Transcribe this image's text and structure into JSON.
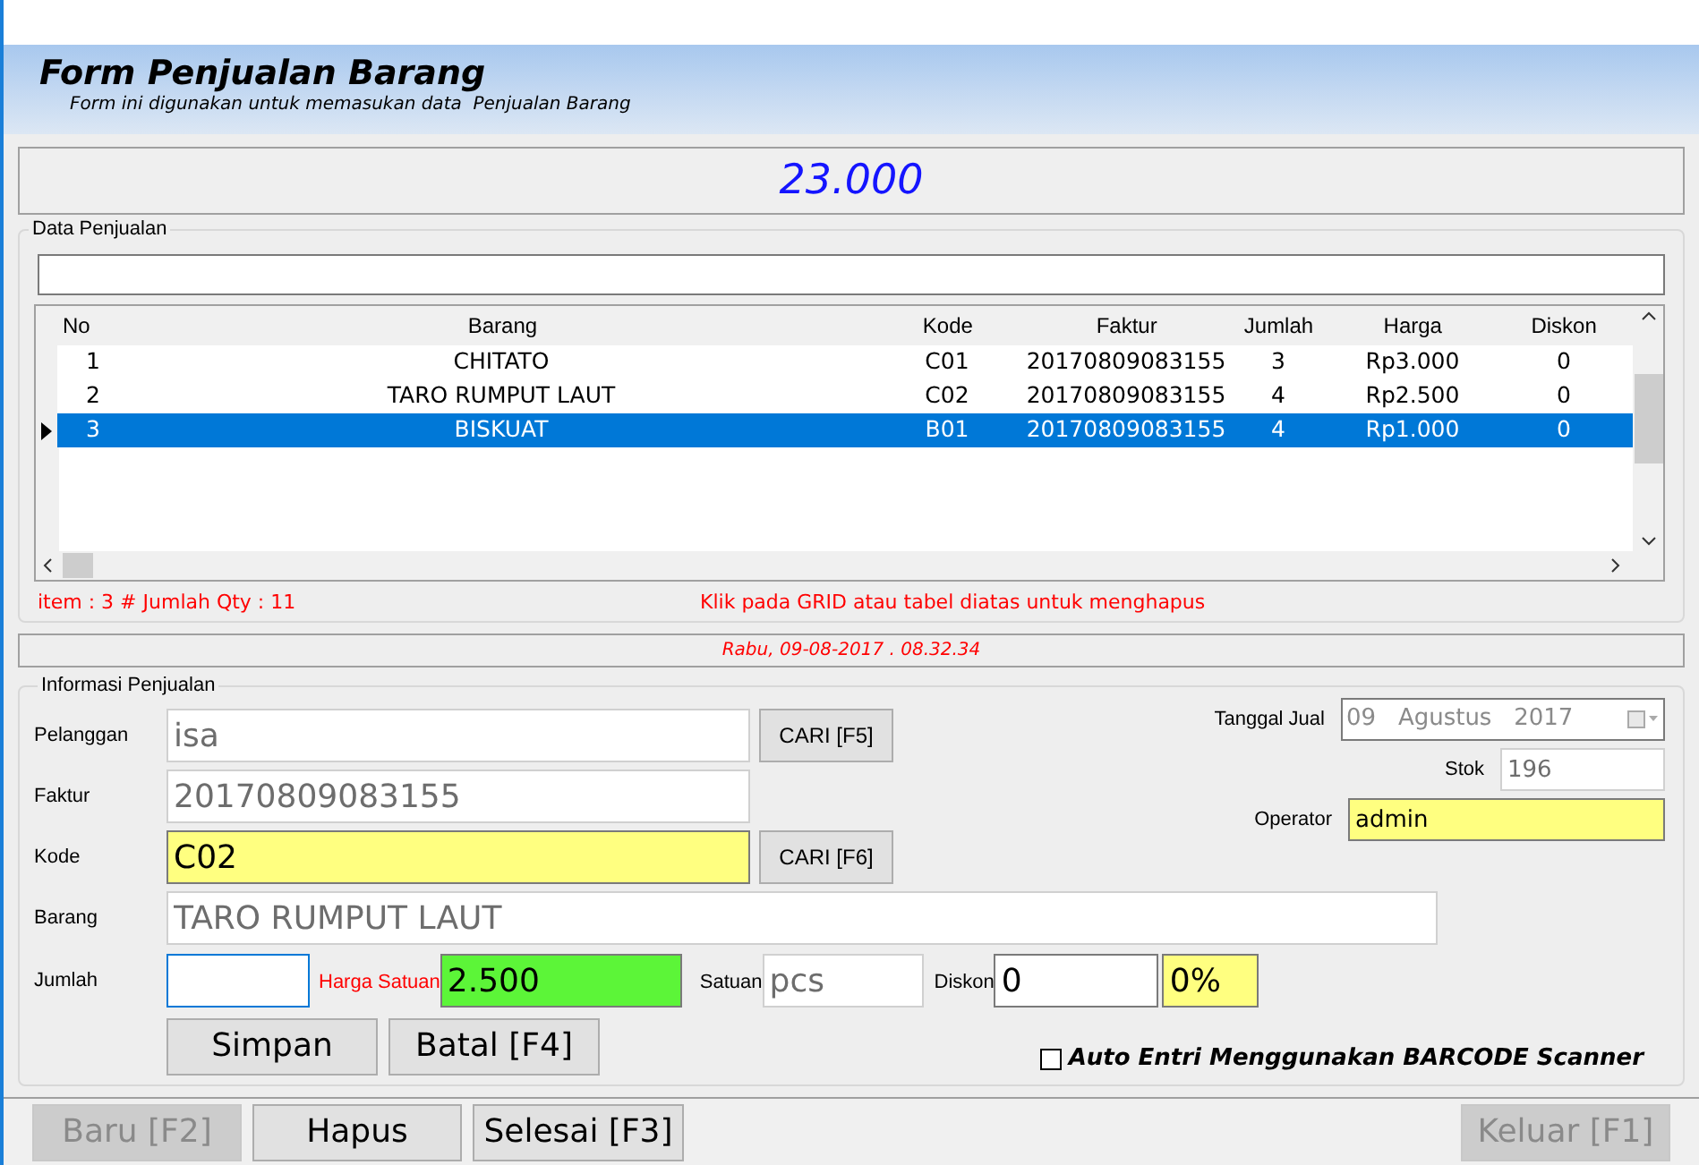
{
  "header": {
    "title": "Form Penjualan Barang",
    "subtitle": "Form ini digunakan untuk memasukan data  Penjualan Barang"
  },
  "total": "23.000",
  "data_penjualan": {
    "legend": "Data Penjualan",
    "table": {
      "columns": [
        "No",
        "Barang",
        "Kode",
        "Faktur",
        "Jumlah",
        "Harga",
        "Diskon"
      ],
      "rows": [
        {
          "cells": [
            "1",
            "CHITATO",
            "C01",
            "20170809083155",
            "3",
            "Rp3.000",
            "0"
          ],
          "selected": false
        },
        {
          "cells": [
            "2",
            "TARO RUMPUT LAUT",
            "C02",
            "20170809083155",
            "4",
            "Rp2.500",
            "0"
          ],
          "selected": false
        },
        {
          "cells": [
            "3",
            "BISKUAT",
            "B01",
            "20170809083155",
            "4",
            "Rp1.000",
            "0"
          ],
          "selected": true
        }
      ]
    },
    "summary": "item : 3 # Jumlah Qty : 11",
    "hint": "Klik pada GRID atau tabel diatas untuk menghapus"
  },
  "datetime": "Rabu, 09-08-2017 . 08.32.34",
  "informasi": {
    "legend": "Informasi Penjualan",
    "pelanggan": {
      "label": "Pelanggan",
      "value": "isa",
      "button": "CARI [F5]"
    },
    "faktur": {
      "label": "Faktur",
      "value": "20170809083155"
    },
    "kode": {
      "label": "Kode",
      "value": "C02",
      "button": "CARI [F6]"
    },
    "barang": {
      "label": "Barang",
      "value": "TARO RUMPUT LAUT"
    },
    "jumlah": {
      "label": "Jumlah"
    },
    "harga_satuan": {
      "label": "Harga Satuan",
      "value": "2.500"
    },
    "satuan": {
      "label": "Satuan",
      "value": "pcs"
    },
    "diskon": {
      "label": "Diskon",
      "value": "0",
      "percent": "0%"
    },
    "tanggal_jual": {
      "label": "Tanggal Jual",
      "value": "09   Agustus   2017"
    },
    "stok": {
      "label": "Stok",
      "value": "196"
    },
    "operator": {
      "label": "Operator",
      "value": "admin"
    },
    "buttons": [
      "Simpan",
      "Batal [F4]"
    ],
    "barcode": {
      "label": "Auto Entri Menggunakan BARCODE Scanner",
      "checked": false
    }
  },
  "toolbar": [
    {
      "label": "Baru [F2]",
      "disabled": true
    },
    {
      "label": "Hapus",
      "disabled": false
    },
    {
      "label": "Selesai [F3]",
      "disabled": false
    },
    {
      "label": "Keluar [F1]",
      "disabled": true
    }
  ]
}
